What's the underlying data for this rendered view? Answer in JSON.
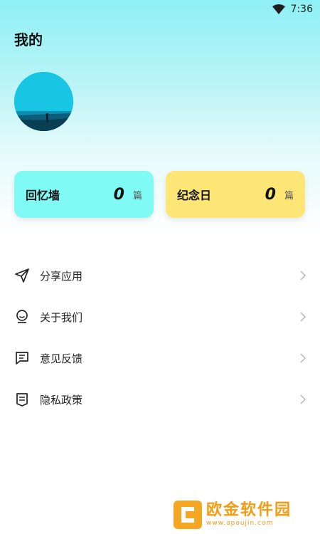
{
  "status_bar": {
    "time": "7:36"
  },
  "header": {
    "title": "我的"
  },
  "stats": [
    {
      "label": "回忆墙",
      "count": "0",
      "unit": "篇",
      "color": "#7ffaf5"
    },
    {
      "label": "纪念日",
      "count": "0",
      "unit": "篇",
      "color": "#fde675"
    }
  ],
  "menu": {
    "items": [
      {
        "label": "分享应用",
        "icon": "send-icon"
      },
      {
        "label": "关于我们",
        "icon": "smiley-icon"
      },
      {
        "label": "意见反馈",
        "icon": "feedback-icon"
      },
      {
        "label": "隐私政策",
        "icon": "policy-icon"
      }
    ]
  },
  "watermark": {
    "title": "欧金软件园",
    "url": "www.apoujin.com"
  }
}
